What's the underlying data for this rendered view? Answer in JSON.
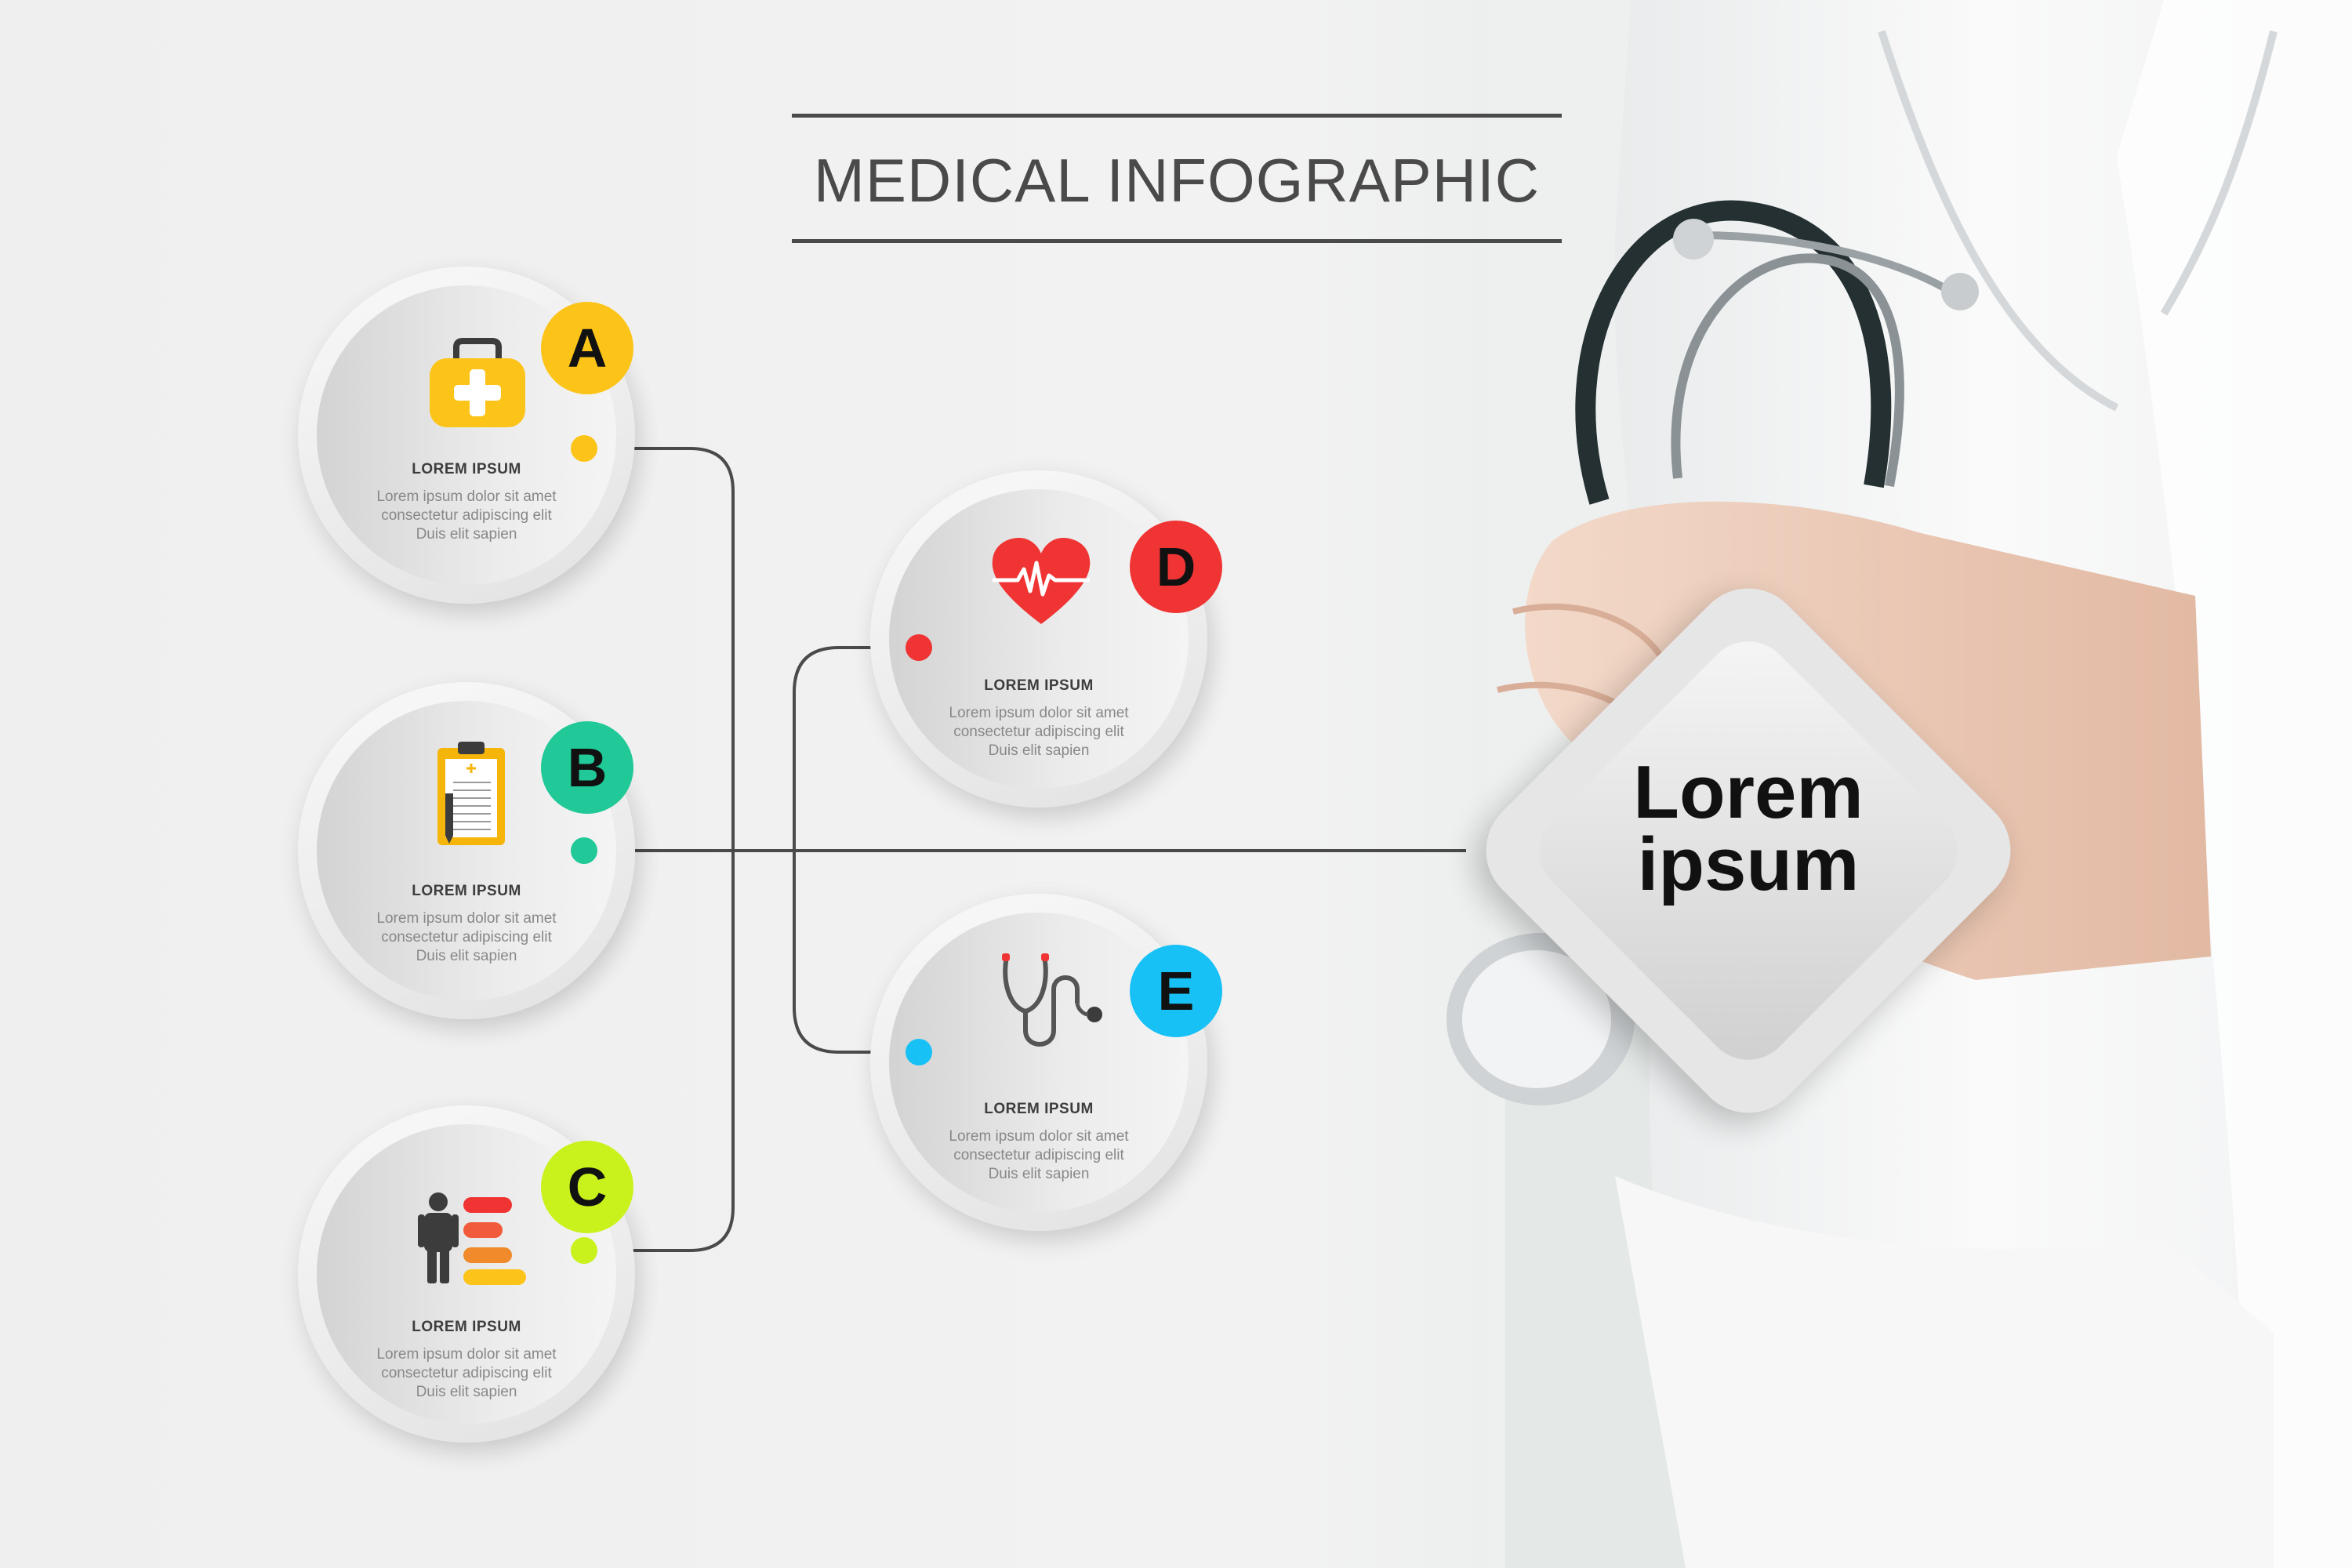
{
  "title": "MEDICAL INFOGRAPHIC",
  "center_label_line1": "Lorem",
  "center_label_line2": "ipsum",
  "colors": {
    "title_rule": "#4a4a4a",
    "connector": "#4a4a4a",
    "a": "#fcc419",
    "b": "#20c997",
    "c": "#c9f21c",
    "d": "#f03434",
    "e": "#17c1f5"
  },
  "nodes": [
    {
      "letter": "A",
      "icon": "first-aid-kit-icon",
      "heading": "LOREM IPSUM",
      "text_line1": "Lorem ipsum dolor sit amet",
      "text_line2": "consectetur adipiscing elit",
      "text_line3": "Duis elit sapien"
    },
    {
      "letter": "B",
      "icon": "clipboard-icon",
      "heading": "LOREM IPSUM",
      "text_line1": "Lorem ipsum dolor sit amet",
      "text_line2": "consectetur adipiscing elit",
      "text_line3": "Duis elit sapien"
    },
    {
      "letter": "C",
      "icon": "person-chart-icon",
      "heading": "LOREM IPSUM",
      "text_line1": "Lorem ipsum dolor sit amet",
      "text_line2": "consectetur adipiscing elit",
      "text_line3": "Duis elit sapien"
    },
    {
      "letter": "D",
      "icon": "heartbeat-icon",
      "heading": "LOREM IPSUM",
      "text_line1": "Lorem ipsum dolor sit amet",
      "text_line2": "consectetur adipiscing elit",
      "text_line3": "Duis elit sapien"
    },
    {
      "letter": "E",
      "icon": "stethoscope-icon",
      "heading": "LOREM IPSUM",
      "text_line1": "Lorem ipsum dolor sit amet",
      "text_line2": "consectetur adipiscing elit",
      "text_line3": "Duis elit sapien"
    }
  ]
}
